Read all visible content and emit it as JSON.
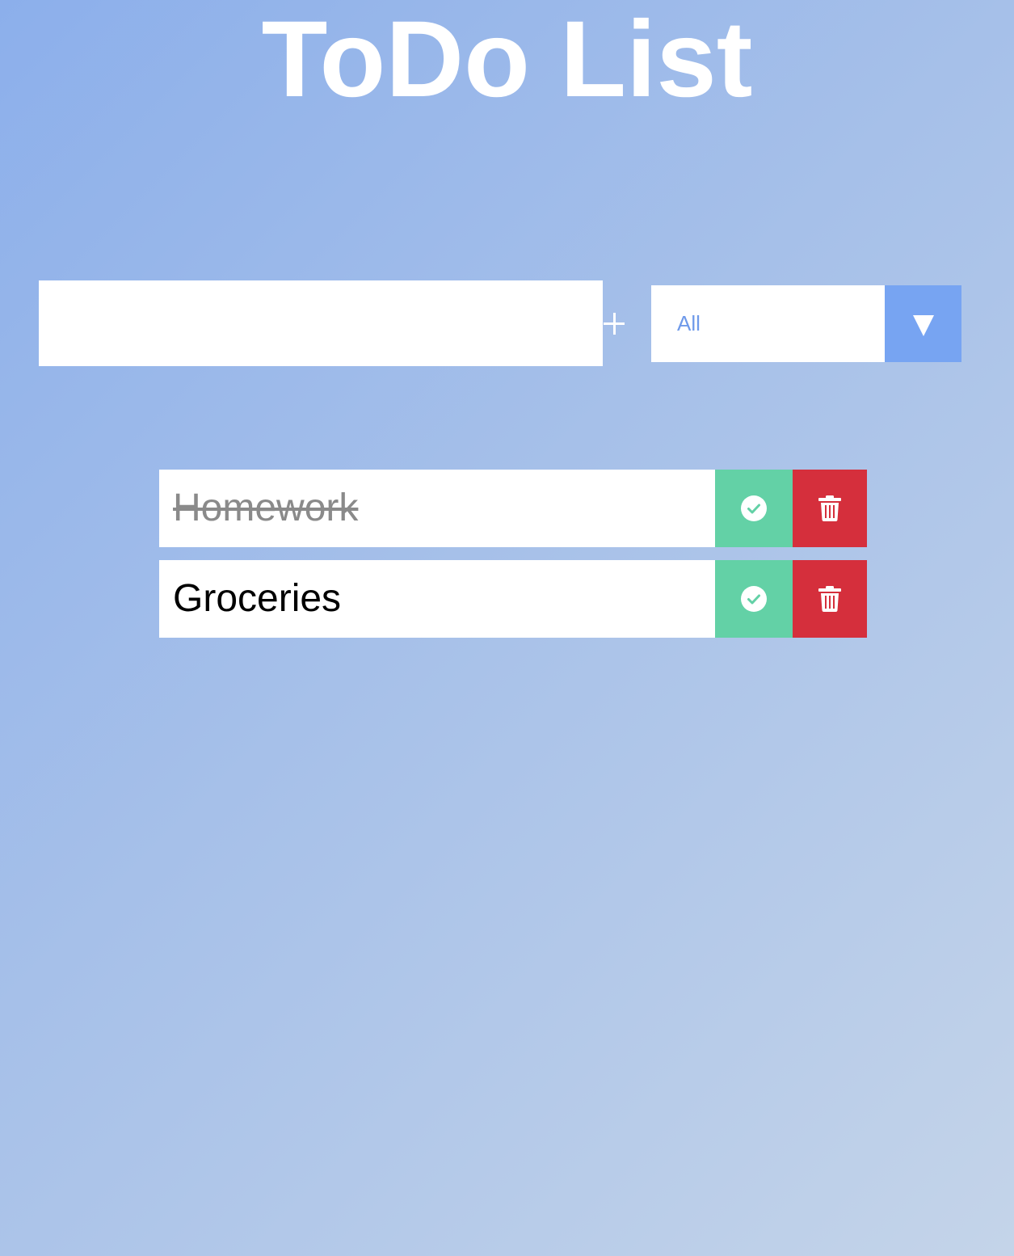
{
  "header": {
    "title": "ToDo List"
  },
  "form": {
    "input_value": "",
    "add_icon": "plus-icon",
    "filter": {
      "selected": "All",
      "arrow_icon": "caret-down-icon"
    }
  },
  "todos": [
    {
      "text": "Homework",
      "completed": true
    },
    {
      "text": "Groceries",
      "completed": false
    }
  ],
  "item_actions": {
    "complete_icon": "check-circle-icon",
    "delete_icon": "trash-icon"
  },
  "colors": {
    "background_start": "#8cafeb",
    "background_end": "#c4d4e9",
    "accent": "#77a4f2",
    "complete": "#63d1a6",
    "delete": "#d52f3c",
    "completed_text": "#8a8a8a"
  }
}
